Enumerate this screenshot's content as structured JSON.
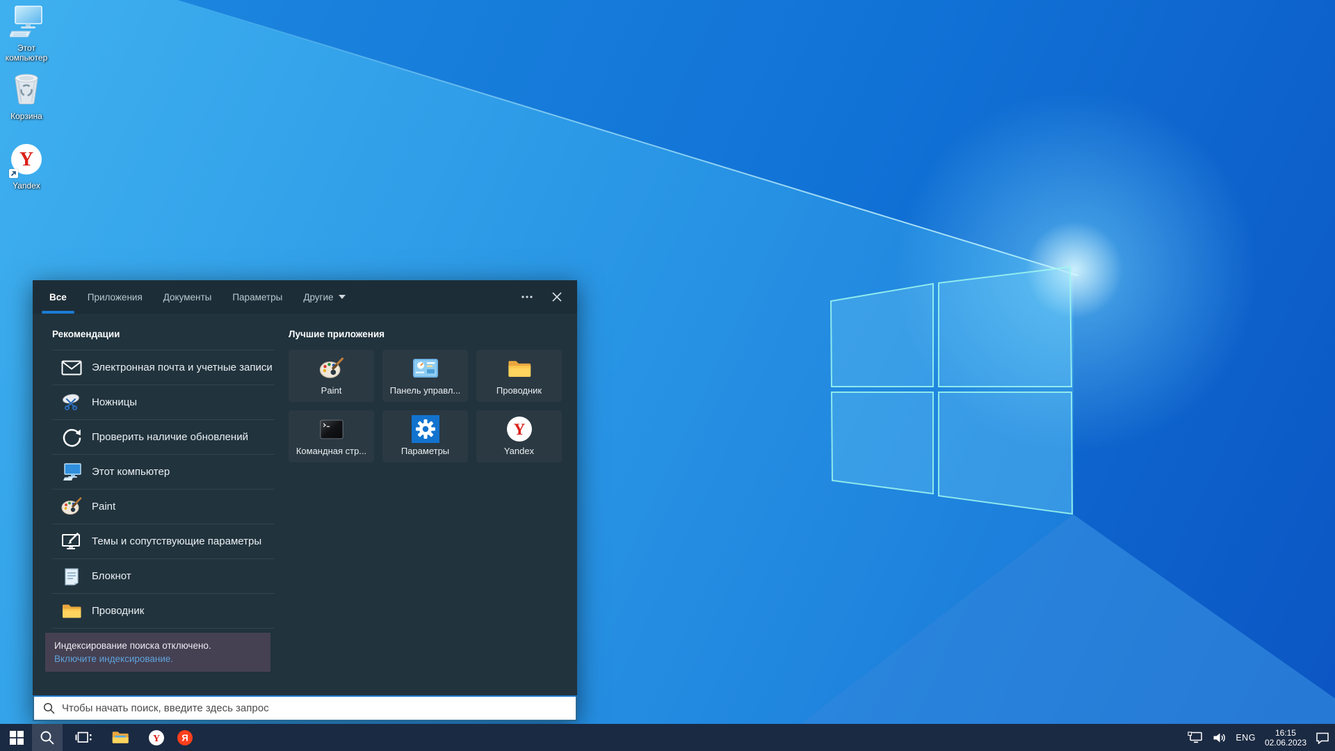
{
  "desktop_icons": [
    {
      "label": "Этот компьютер"
    },
    {
      "label": "Корзина"
    },
    {
      "label": "Yandex"
    }
  ],
  "panel": {
    "tabs": [
      "Все",
      "Приложения",
      "Документы",
      "Параметры",
      "Другие"
    ],
    "recommendations_title": "Рекомендации",
    "recommendations": [
      {
        "label": "Электронная почта и учетные записи",
        "icon": "mail-icon"
      },
      {
        "label": "Ножницы",
        "icon": "snipping-tool-icon"
      },
      {
        "label": "Проверить наличие обновлений",
        "icon": "update-icon"
      },
      {
        "label": "Этот компьютер",
        "icon": "this-pc-icon"
      },
      {
        "label": "Paint",
        "icon": "paint-icon"
      },
      {
        "label": "Темы и сопутствующие параметры",
        "icon": "themes-icon"
      },
      {
        "label": "Блокнот",
        "icon": "notepad-icon"
      },
      {
        "label": "Проводник",
        "icon": "folder-icon"
      }
    ],
    "top_apps_title": "Лучшие приложения",
    "top_apps": [
      {
        "label": "Paint",
        "icon": "paint-icon"
      },
      {
        "label": "Панель управл...",
        "icon": "control-panel-icon"
      },
      {
        "label": "Проводник",
        "icon": "folder-icon"
      },
      {
        "label": "Командная стр...",
        "icon": "cmd-icon"
      },
      {
        "label": "Параметры",
        "icon": "settings-gear-icon"
      },
      {
        "label": "Yandex",
        "icon": "yandex-icon"
      }
    ],
    "notice_text": "Индексирование поиска отключено.",
    "notice_link": "Включите индексирование.",
    "search_placeholder": "Чтобы начать поиск, введите здесь запрос"
  },
  "taskbar": {
    "language": "ENG",
    "time": "16:15",
    "date": "02.06.2023"
  },
  "letters": {
    "yandex": "Y",
    "yandex_ru": "Я"
  },
  "colors": {
    "accent": "#1a7cd4",
    "panel": "#21333d",
    "tile": "#2b3943",
    "taskbar": "#1b2a43",
    "notice_bg": "#454052",
    "link": "#5ea3dc",
    "wallpaper_light": "#2b98e6",
    "wallpaper_dark": "#0b55c3"
  }
}
